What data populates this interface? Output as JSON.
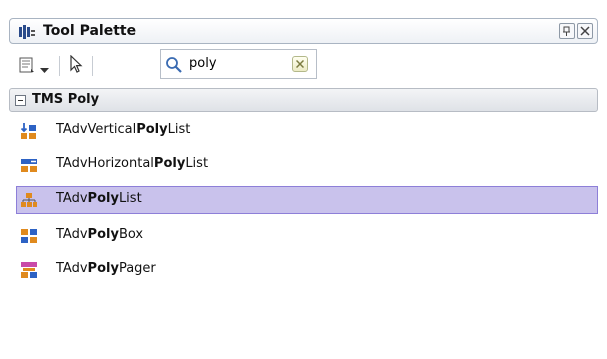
{
  "window": {
    "title": "Tool Palette",
    "buttons": [
      {
        "name": "pin",
        "icon": "pin-icon"
      },
      {
        "name": "close",
        "icon": "close-icon"
      }
    ]
  },
  "toolbar": {
    "categories_icon": "categories-icon",
    "dropdown_icon": "chevron-down-icon",
    "pointer_icon": "pointer-arrow-icon",
    "search": {
      "value": "poly",
      "icon": "search-icon",
      "clear_icon": "clear-icon"
    }
  },
  "category": {
    "label": "TMS Poly",
    "expanded": true
  },
  "items": [
    {
      "pre": "TAdvVertical",
      "match": "Poly",
      "post": "List",
      "icon": "vertical-list-icon",
      "selected": false
    },
    {
      "pre": "TAdvHorizontal",
      "match": "Poly",
      "post": "List",
      "icon": "horizontal-list-icon",
      "selected": false
    },
    {
      "pre": "TAdv",
      "match": "Poly",
      "post": "List",
      "icon": "poly-list-icon",
      "selected": true
    },
    {
      "pre": "TAdv",
      "match": "Poly",
      "post": "Box",
      "icon": "poly-box-icon",
      "selected": false
    },
    {
      "pre": "TAdv",
      "match": "Poly",
      "post": "Pager",
      "icon": "poly-pager-icon",
      "selected": false
    }
  ],
  "colors": {
    "selection_bg": "#c9c2ec",
    "selection_border": "#8d7fd8"
  }
}
